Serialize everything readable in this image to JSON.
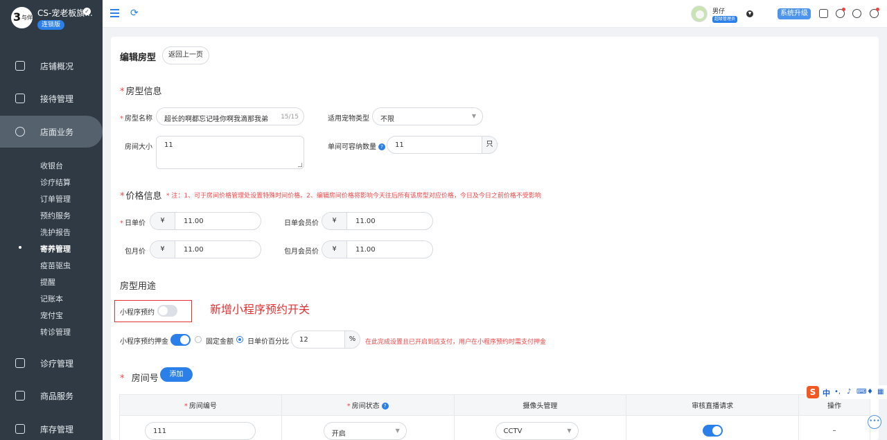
{
  "brand": {
    "name": "CS-宠老板旗...",
    "edition": "连锁版",
    "logo_mark": "与伴"
  },
  "sidebar": {
    "items": [
      {
        "label": "店铺概况",
        "icon": "monitor-icon"
      },
      {
        "label": "接待管理",
        "icon": "reception-icon"
      },
      {
        "label": "店面业务",
        "icon": "store-icon"
      },
      {
        "label": "诊疗管理",
        "icon": "medical-icon"
      },
      {
        "label": "商品服务",
        "icon": "goods-icon"
      },
      {
        "label": "库存管理",
        "icon": "inventory-icon"
      }
    ],
    "sub_items": [
      "收银台",
      "诊疗结算",
      "订单管理",
      "预约服务",
      "洗护报告",
      "寄养管理",
      "疫苗驱虫",
      "提醒",
      "记账本",
      "宠付宝",
      "转诊管理"
    ],
    "active_sub": "寄养管理"
  },
  "topbar": {
    "user_name": "男仔",
    "user_role": "超级管理员",
    "upgrade": "系统升级"
  },
  "page": {
    "title": "编辑房型",
    "back": "返回上一页",
    "room_info": {
      "section": "房型信息",
      "name_label": "房型名称",
      "name_value": "超长的啊都忘记哇你啊我滴那我弟",
      "name_count": "15/15",
      "pet_type_label": "适用宠物类型",
      "pet_type_value": "不限",
      "size_label": "房间大小",
      "size_value": "11",
      "capacity_label": "单间可容纳数量",
      "capacity_value": "11",
      "capacity_unit": "只"
    },
    "price_info": {
      "section": "价格信息",
      "note": "* 注：1、可于房间价格管理处设置特殊时间价格。2、编辑房间价格将影响今天往后所有该房型对应价格，今日及今日之前价格不受影响",
      "currency": "¥",
      "daily_label": "日单价",
      "daily_value": "11.00",
      "daily_member_label": "日单会员价",
      "daily_member_value": "11.00",
      "monthly_label": "包月价",
      "monthly_value": "11.00",
      "monthly_member_label": "包月会员价",
      "monthly_member_value": "11.00"
    },
    "usage": {
      "section": "房型用途",
      "mini_booking_label": "小程序预约",
      "callout": "新增小程序预约开关",
      "deposit_label": "小程序预约押金",
      "fixed_label": "固定金额",
      "percent_label": "日单价百分比",
      "percent_value": "12",
      "percent_unit": "%",
      "deposit_note": "在此完成设置且已开启到店支付，用户在小程序预约时需支付押金"
    },
    "rooms": {
      "section": "房间号",
      "add": "添加",
      "headers": [
        "房间编号",
        "房间状态",
        "摄像头管理",
        "审核直播请求",
        "操作"
      ],
      "row": {
        "number": "111",
        "status": "开启",
        "camera": "CCTV",
        "action": "–"
      }
    }
  },
  "ime": {
    "lang": "中",
    "punct": "•,"
  }
}
